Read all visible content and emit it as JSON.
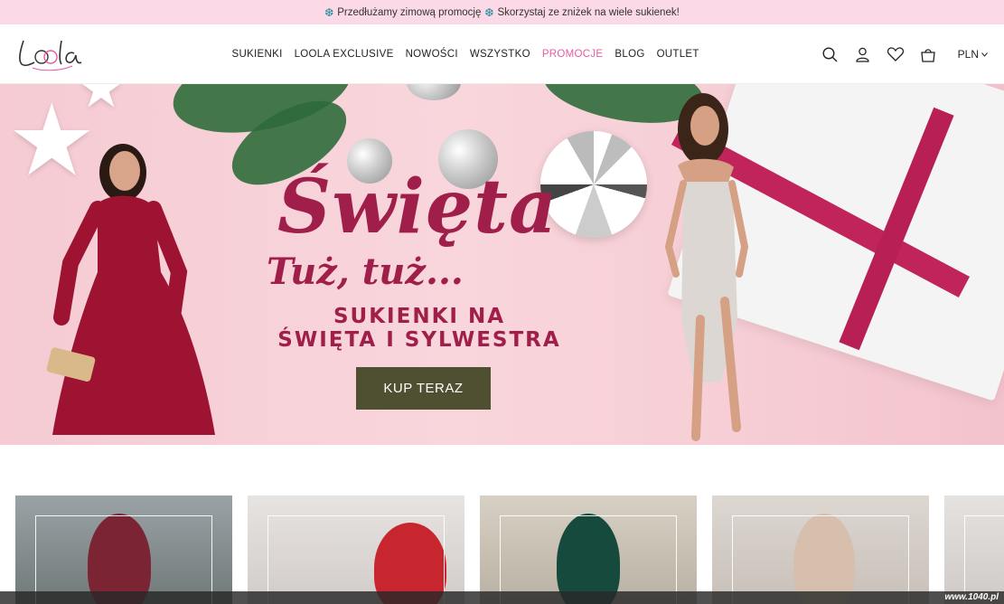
{
  "promo": {
    "text1": "Przedłużamy zimową promocję",
    "text2": "Skorzystaj ze zniżek na wiele sukienek!"
  },
  "header": {
    "logo_text": "Loola",
    "nav": [
      "SUKIENKI",
      "LOOLA EXCLUSIVE",
      "NOWOŚCI",
      "WSZYSTKO",
      "PROMOCJE",
      "BLOG",
      "OUTLET"
    ],
    "active_nav": "PROMOCJE",
    "currency": "PLN"
  },
  "hero": {
    "title": "Święta",
    "subtitle": "Tuż, tuż...",
    "tagline_line1": "SUKIENKI NA",
    "tagline_line2": "ŚWIĘTA I SYLWESTRA",
    "button": "KUP TERAZ"
  },
  "colors": {
    "accent_pink": "#e85aa2",
    "hero_text": "#a01e4a",
    "button_bg": "#4f4f32",
    "promo_bg": "#fbd9e6"
  },
  "icons": [
    "search-icon",
    "user-icon",
    "heart-icon",
    "cart-icon",
    "chevron-down-icon",
    "snowflake-icon"
  ],
  "watermark": "www.1040.pl"
}
